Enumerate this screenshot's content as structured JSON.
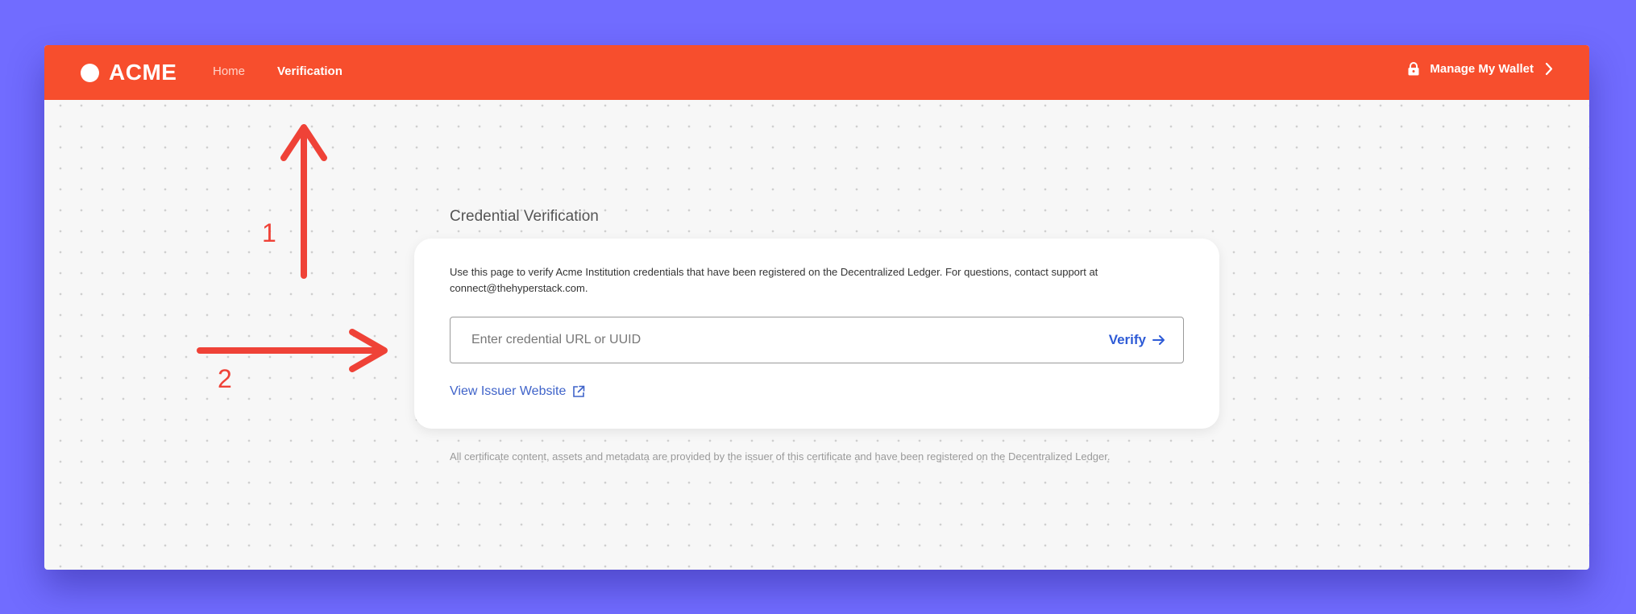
{
  "colors": {
    "background": "#716cff",
    "navbar": "#f74e2d",
    "accent_link": "#2e5bd6",
    "annotation": "#ef4237"
  },
  "header": {
    "brand": "ACME",
    "nav": [
      {
        "label": "Home",
        "active": false
      },
      {
        "label": "Verification",
        "active": true
      }
    ],
    "wallet_label": "Manage My Wallet",
    "icons": [
      "lock-icon",
      "chevron-right-icon"
    ]
  },
  "main": {
    "title": "Credential Verification",
    "description": "Use this page to verify Acme Institution credentials that have been registered on the Decentralized Ledger. For questions, contact support at connect@thehyperstack.com.",
    "input": {
      "value": "",
      "placeholder": "Enter credential URL or UUID"
    },
    "verify_label": "Verify",
    "issuer_link": "View Issuer Website",
    "footer_note": "All certificate content, assets and metadata are provided by the issuer of this certificate and have been registered on the Decentralized Ledger."
  },
  "annotations": [
    {
      "label": "1",
      "direction": "up"
    },
    {
      "label": "2",
      "direction": "right"
    }
  ]
}
